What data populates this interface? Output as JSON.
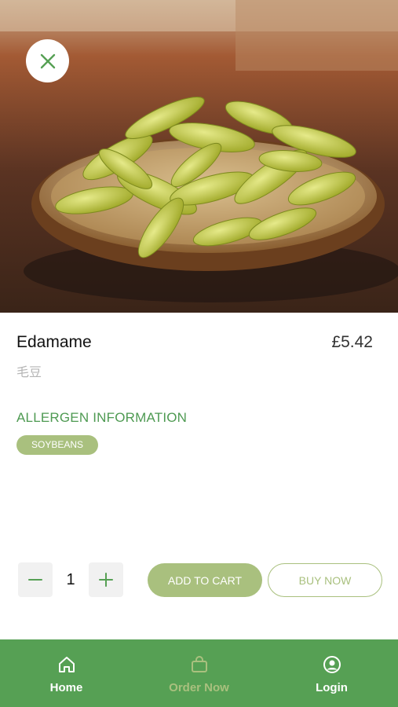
{
  "product": {
    "name": "Edamame",
    "name_cn": "毛豆",
    "price": "£5.42"
  },
  "allergen": {
    "heading": "ALLERGEN INFORMATION",
    "tags": [
      "SOYBEANS"
    ]
  },
  "quantity": {
    "value": "1"
  },
  "actions": {
    "add_to_cart": "ADD TO CART",
    "buy_now": "BUY NOW"
  },
  "nav": {
    "items": [
      {
        "label": "Home",
        "icon": "home-icon"
      },
      {
        "label": "Order Now",
        "icon": "bag-icon"
      },
      {
        "label": "Login",
        "icon": "user-circle-icon"
      }
    ]
  },
  "colors": {
    "brand_green": "#56a054",
    "accent_olive": "#a9c07e",
    "heading_green": "#4e9a52"
  }
}
